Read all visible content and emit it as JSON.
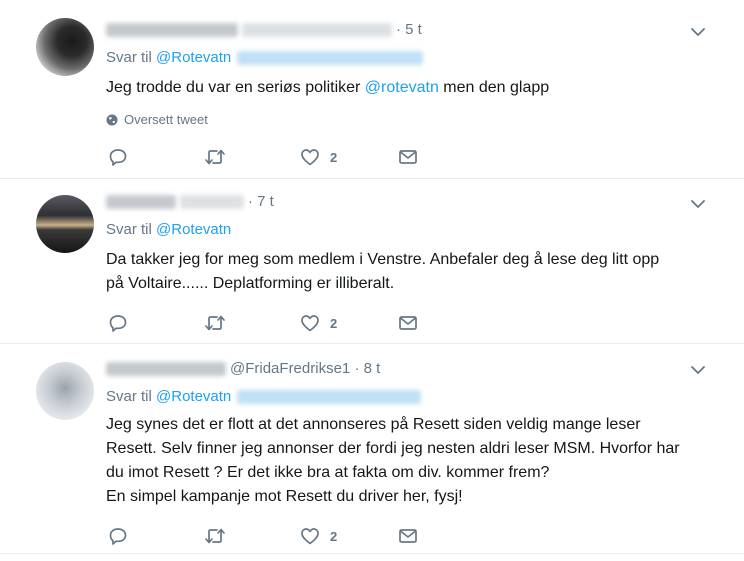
{
  "tweets": [
    {
      "handle": "",
      "time": "5 t",
      "reply_prefix": "Svar til",
      "reply_mention": "@Rotevatn",
      "text_before": "Jeg trodde du var en seriøs politiker ",
      "text_mention": "@rotevatn",
      "text_after": " men den glapp",
      "translate_label": "Oversett tweet",
      "likes": "2"
    },
    {
      "handle": "",
      "time": "7 t",
      "reply_prefix": "Svar til",
      "reply_mention": "@Rotevatn",
      "line1": "Da takker jeg for meg som medlem i Venstre.  Anbefaler deg å lese deg litt opp",
      "line2": "på Voltaire......  Deplatforming er illiberalt.",
      "likes": "2"
    },
    {
      "handle": "@FridaFredrikse1",
      "time": "8 t",
      "reply_prefix": "Svar til",
      "reply_mention": "@Rotevatn",
      "line1": "Jeg synes det er flott at det annonseres på Resett siden veldig mange leser",
      "line2": "Resett. Selv finner jeg annonser der fordi jeg nesten aldri leser MSM. Hvorfor har",
      "line3": "du imot Resett ? Er det ikke bra at fakta om div. kommer frem?",
      "line4": "En simpel kampanje  mot Resett du driver her, fysj!",
      "likes": "2"
    }
  ],
  "separator": "·",
  "icons": {
    "reply": "reply-icon",
    "retweet": "retweet-icon",
    "like": "heart-icon",
    "dm": "envelope-icon",
    "menu": "chevron-down-icon",
    "translate": "globe-icon"
  },
  "colors": {
    "accent": "#1da1f2",
    "muted": "#657786",
    "text": "#14171a",
    "divider": "#e6ecf0"
  }
}
